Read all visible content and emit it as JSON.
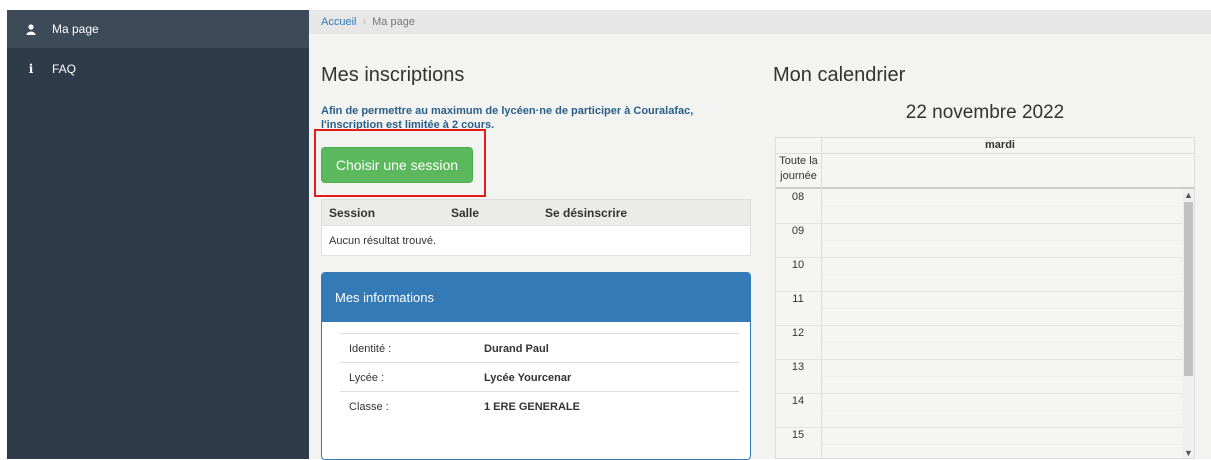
{
  "sidebar": {
    "items": [
      {
        "label": "Ma page",
        "icon": "user-icon"
      },
      {
        "label": "FAQ",
        "icon": "info-icon"
      }
    ]
  },
  "breadcrumb": {
    "home": "Accueil",
    "separator": "›",
    "current": "Ma page"
  },
  "inscriptions": {
    "title": "Mes inscriptions",
    "notice": "Afin de permettre au maximum de lycéen·ne de participer à Couralafac, l'inscription est limitée à 2 cours.",
    "choose_button": "Choisir une session",
    "table": {
      "columns": [
        "Session",
        "Salle",
        "Se désinscrire"
      ],
      "empty": "Aucun résultat trouvé."
    }
  },
  "informations": {
    "title": "Mes informations",
    "rows": [
      {
        "label": "Identité :",
        "value": "Durand Paul"
      },
      {
        "label": "Lycée :",
        "value": "Lycée Yourcenar"
      },
      {
        "label": "Classe :",
        "value": "1 ERE GENERALE"
      }
    ]
  },
  "calendar": {
    "title": "Mon calendrier",
    "date": "22 novembre 2022",
    "day": "mardi",
    "all_day": "Toute la journée",
    "hours": [
      "08",
      "09",
      "10",
      "11",
      "12",
      "13",
      "14",
      "15"
    ]
  },
  "colors": {
    "sidebar": "#2e3b48",
    "primary": "#337ab7",
    "success": "#5cb85c",
    "highlight": "#e31c1c"
  }
}
